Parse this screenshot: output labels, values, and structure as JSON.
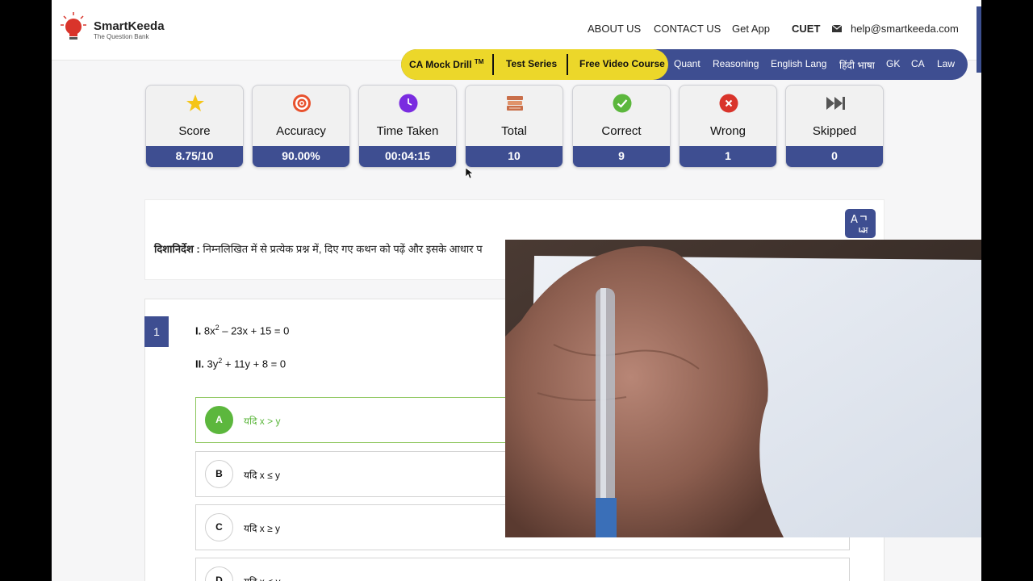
{
  "brand": {
    "name": "SmartKeeda",
    "tagline": "The Question Bank"
  },
  "topnav": {
    "about": "ABOUT US",
    "contact": "CONTACT US",
    "app": "Get App",
    "cuet": "CUET",
    "email": "help@smartkeeda.com"
  },
  "navbar": {
    "highlight": [
      "CA Mock Drill",
      "Test Series",
      "Free Video Course"
    ],
    "tm": "TM",
    "links": [
      "Quant",
      "Reasoning",
      "English Lang",
      "हिंदी भाषा",
      "GK",
      "CA",
      "Law"
    ]
  },
  "stats": [
    {
      "label": "Score",
      "value": "8.75/10",
      "icon": "star-icon"
    },
    {
      "label": "Accuracy",
      "value": "90.00%",
      "icon": "target-icon"
    },
    {
      "label": "Time Taken",
      "value": "00:04:15",
      "icon": "clock-icon"
    },
    {
      "label": "Total",
      "value": "10",
      "icon": "books-icon"
    },
    {
      "label": "Correct",
      "value": "9",
      "icon": "check-icon"
    },
    {
      "label": "Wrong",
      "value": "1",
      "icon": "cross-icon"
    },
    {
      "label": "Skipped",
      "value": "0",
      "icon": "skip-icon"
    }
  ],
  "colors": {
    "brand_blue": "#3e4e91",
    "highlight_yellow": "#ecd72a",
    "correct_green": "#5cb73d",
    "wrong_red": "#d9342b"
  },
  "direction": {
    "label": "दिशानिर्देश :",
    "text": "निम्नलिखित में से प्रत्येक प्रश्न में, दिए गए कथन को पढ़ें और इसके आधार प"
  },
  "question": {
    "number": "1",
    "eq1": {
      "roman": "I.",
      "a": "8x",
      "exp": "2",
      "b": " – 23x + 15 = 0"
    },
    "eq2": {
      "roman": "II.",
      "a": "3y",
      "exp": "2",
      "b": " + 11y + 8 = 0"
    },
    "options": [
      {
        "letter": "A",
        "text": "यदि x > y"
      },
      {
        "letter": "B",
        "text": "यदि x ≤ y"
      },
      {
        "letter": "C",
        "text": "यदि x ≥ y"
      },
      {
        "letter": "D",
        "text": "यदि x < y"
      }
    ]
  }
}
